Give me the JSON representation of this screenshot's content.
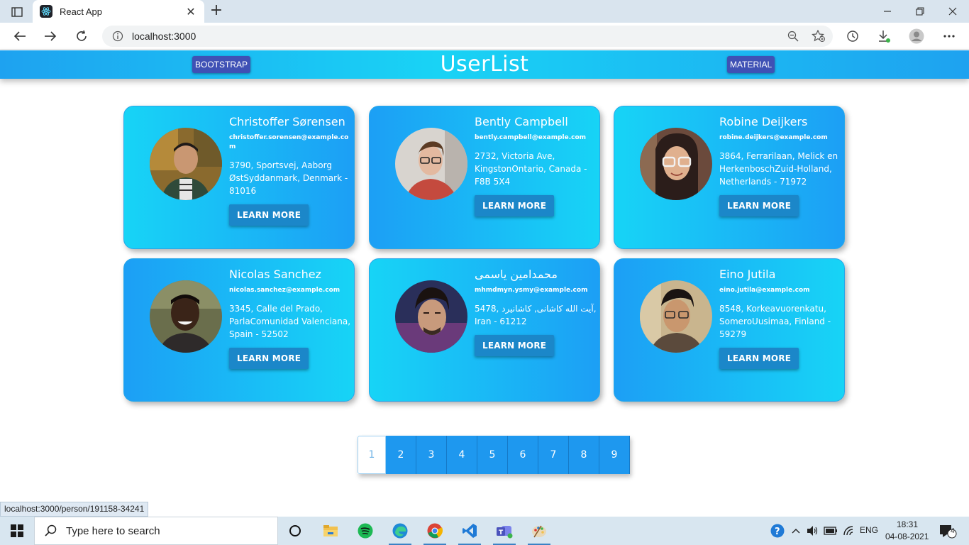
{
  "browser": {
    "tab_title": "React App",
    "url": "localhost:3000",
    "status_url": "localhost:3000/person/191158-34241"
  },
  "header": {
    "title": "UserList",
    "bootstrap_label": "BOOTSTRAP",
    "material_label": "MATERIAL"
  },
  "users": [
    {
      "name": "Christoffer Sørensen",
      "email": "christoffer.sorensen@example.com",
      "address": "3790, Sportsvej, Aaborg ØstSyddanmark, Denmark - 81016",
      "button": "LEARN MORE"
    },
    {
      "name": "Bently Campbell",
      "email": "bently.campbell@example.com",
      "address": "2732, Victoria Ave, KingstonOntario, Canada - F8B 5X4",
      "button": "LEARN MORE"
    },
    {
      "name": "Robine Deijkers",
      "email": "robine.deijkers@example.com",
      "address": "3864, Ferrarilaan, Melick en HerkenboschZuid-Holland, Netherlands - 71972",
      "button": "LEARN MORE"
    },
    {
      "name": "Nicolas Sanchez",
      "email": "nicolas.sanchez@example.com",
      "address": "3345, Calle del Prado, ParlaComunidad Valenciana, Spain - 52502",
      "button": "LEARN MORE"
    },
    {
      "name": "محمدامین یاسمی",
      "email": "mhmdmyn.ysmy@example.com",
      "address": "5478, آیت الله کاشانی, کاشانیرد, Iran - 61212",
      "button": "LEARN MORE"
    },
    {
      "name": "Eino Jutila",
      "email": "eino.jutila@example.com",
      "address": "8548, Korkeavuorenkatu, SomeroUusimaa, Finland - 59279",
      "button": "LEARN MORE"
    }
  ],
  "pagination": {
    "pages": [
      "1",
      "2",
      "3",
      "4",
      "5",
      "6",
      "7",
      "8",
      "9"
    ],
    "active": "1"
  },
  "taskbar": {
    "search_placeholder": "Type here to search",
    "language": "ENG",
    "time": "18:31",
    "date": "04-08-2021",
    "notification_count": "4"
  },
  "colors": {
    "header_gradient": [
      "#1ea2f0",
      "#19d3f5"
    ],
    "card_gradient": [
      "#17d4f6",
      "#1c9ff5"
    ],
    "button": "#1b87c9",
    "header_button": "#3f51b5"
  }
}
